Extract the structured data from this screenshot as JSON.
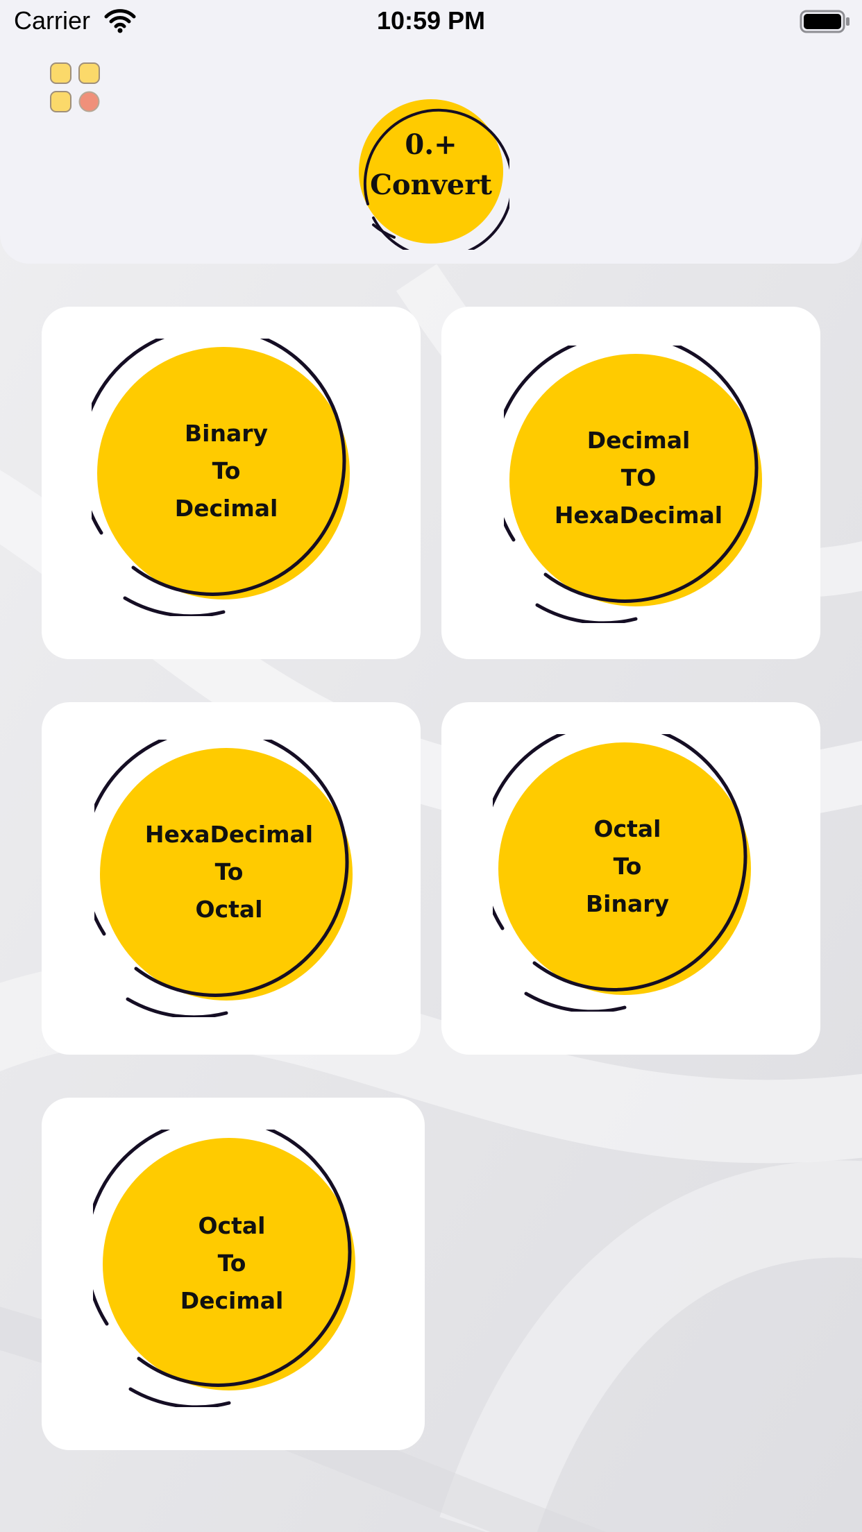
{
  "status_bar": {
    "carrier": "Carrier",
    "time": "10:59 PM",
    "icons": [
      "wifi-icon",
      "battery-icon"
    ]
  },
  "header": {
    "menu_icon": "grid-menu-icon",
    "logo": {
      "line1": "0.+",
      "line2": "Convert"
    }
  },
  "colors": {
    "accent_yellow": "#ffcb00",
    "outline": "#150e24",
    "card": "#ffffff",
    "header_bg": "#f2f2f7",
    "menu_tile_yellow": "#fbd96a",
    "menu_tile_salmon": "#f0907a"
  },
  "converters": [
    {
      "line1": "Binary",
      "line2": "To",
      "line3": "Decimal"
    },
    {
      "line1": "Decimal",
      "line2": "TO",
      "line3": "HexaDecimal"
    },
    {
      "line1": "HexaDecimal",
      "line2": "To",
      "line3": "Octal"
    },
    {
      "line1": "Octal",
      "line2": "To",
      "line3": "Binary"
    },
    {
      "line1": "Octal",
      "line2": "To",
      "line3": "Decimal"
    }
  ]
}
